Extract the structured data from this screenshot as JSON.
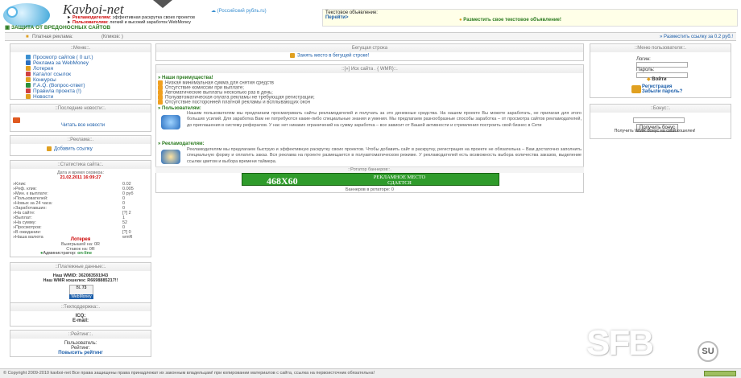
{
  "header": {
    "logo_text": "Kavboi-net",
    "slogan_1_bold": "Рекламодателям:",
    "slogan_1": "эффективная раскрутка своих проектов",
    "slogan_2_bold": "Пользователям:",
    "slogan_2": "легкий и высокий заработок WebMoney",
    "shield": "ЗАЩИТА ОТ ВРЕДОНОСНЫХ САЙТОВ",
    "yandex_link": "(Российский рубль.ru)",
    "ad_title": "Текстовое объявление:",
    "ad_go": "Перейти>",
    "ad_place": "Разместить свое текстовое объявление!"
  },
  "topbar": {
    "paid": "Платная реклама:",
    "click": "(Кликов: )",
    "place_link": "» Разместить ссылку за 0.2 руб.!"
  },
  "left": {
    "menu_title": "::Меню::.",
    "menu": [
      {
        "label": "Просмотр сайтов ( 0 шт.)",
        "icon": "magnifier-icon",
        "color": "#3a8fd0"
      },
      {
        "label": "Реклама за WebMoney",
        "icon": "webmoney-icon",
        "color": "#2a6fc0"
      },
      {
        "label": "Лотерея",
        "icon": "lottery-icon",
        "color": "#e0a020"
      },
      {
        "label": "Каталог ссылок",
        "icon": "catalog-icon",
        "color": "#d04040"
      },
      {
        "label": "Конкурсы",
        "icon": "contest-icon",
        "color": "#e0a020"
      },
      {
        "label": "F.A.Q. (Вопрос-ответ)",
        "icon": "faq-icon",
        "color": "#2a8f3a"
      },
      {
        "label": "Правила проекта (!)",
        "icon": "rules-icon",
        "color": "#d04040"
      },
      {
        "label": "Новости",
        "icon": "news-icon",
        "color": "#e0a020"
      }
    ],
    "news_title": "::Последние новости::.",
    "news_link": "Читать все новости",
    "ads_title": "::Реклама::.",
    "ads_link": "Добавить ссылку",
    "stats_title": "::Статистика сайта::.",
    "stats_date_label": "Дата и время сервера:",
    "stats_date": "21.02.2011 16:09:27",
    "stats": [
      {
        "k": "»Клик:",
        "v": "0.02"
      },
      {
        "k": "»Реф. клик:",
        "v": "0.005"
      },
      {
        "k": "»Мин. к выплате:",
        "v": "0 руб"
      },
      {
        "k": "»Пользователей:",
        "v": "0"
      },
      {
        "k": "»Новых за 24 часа:",
        "v": "0"
      },
      {
        "k": "»Заработавших:",
        "v": "0"
      },
      {
        "k": "»На сайте:",
        "v": "[?] 2"
      },
      {
        "k": "»Выплат:",
        "v": "1"
      },
      {
        "k": "»На сумму:",
        "v": "52"
      },
      {
        "k": "»Просмотров:",
        "v": "0"
      },
      {
        "k": "»В ожидании:",
        "v": "[?] 0"
      },
      {
        "k": "»Наша валюта",
        "v": "wmR"
      }
    ],
    "lottery_title": "Лотерея",
    "lottery_win": "Выигрышей на: 0R",
    "lottery_bets": "Ставок на: 0R",
    "admin": "Администратор:",
    "admin_status": "on-line",
    "pay_title": "::Платежные данные::.",
    "wmid": "Наш WMID: 362083591943",
    "wmr": "Наш WMR кошелек: R6698885217!!",
    "bl_label": "BL",
    "bl_value": "73",
    "wm_badge": "WebMoney",
    "support_title": "::Техподдержка::.",
    "icq": "ICQ:",
    "email": "E-mail:",
    "rating_title": "::Рейтинг::.",
    "rating_users": "Пользователь:",
    "rating_label": "Рейтинг:",
    "rating_link": "Повысить рейтинг"
  },
  "center": {
    "ticker_title": "Бегущая строка",
    "ticker_link": "Занять место в бегущей строке!",
    "income_title": "::[»] Иск сайта . { WMR}::.",
    "adv_title": "» Наши преимущества!",
    "adv": [
      "Низкая минимальная сумма для снятия средств",
      "Отсутствие комиссии при выплате;",
      "Автоматические выплаты несколько раз в день;",
      "Полуавтоматическая оплата рекламы не требующая регистрации;",
      "Отсутствие посторонней платной рекламы и всплывающих окон"
    ],
    "users_title": "» Пользователям:",
    "users_text": "Нашим пользователям мы предлагаем просматривать сайты рекламодателей и получать за это денежные средства. На нашем проекте Вы можете заработать, не прилагая для этого больших усилий. Для заработка Вам не потребуются какие-либо специальные знания и умения. Мы предлагаем разнообразные способы заработка – от просмотра сайтов рекламодателей, до приглашения в систему рефералов. У нас нет никаких ограничений на сумму заработка – все зависит от Вашей активности и стремления построить свой бизнес в Сети",
    "advertisers_title": "» Рекламодателям:",
    "advertisers_text": "Рекламодателям мы предлагаем быструю и эффективную раскрутку своих проектов. Чтобы добавить сайт в раскрутку, регистрация на проекте не обязательна – Вам достаточно заполнить специальную форму и оплатить заказ. Вся реклама на проекте размещается в полуавтоматическом режиме. У рекламодателей есть возможность выбора количества заказов, выделение ссылки цветом и выбора времени таймера.",
    "rotator_title": "::Ротатор баннеров::.",
    "banner_size": "468X60",
    "banner_text": "РЕКЛАМНОЕ МЕСТО СДАЕТСЯ",
    "rotator_count": "Баннеров в ротаторе: 0"
  },
  "right": {
    "user_menu_title": "::Меню пользователя::.",
    "login_label": "Логин:",
    "password_label": "Пароль:",
    "login_btn": "Войти",
    "register": "Регистрация",
    "forgot": "Забыли пароль?",
    "bonus_title": "::Бонус::.",
    "bonus_btn": "Получить бонус",
    "bonus_text": "Получить WMR бонус на свой кошелек!"
  },
  "footer": {
    "copyright": "© Copyright 2009-2010 kavboi-net Все права защищены права принадлежат их законным владельцам! при копировании материалов с сайта, ссылка на первоисточник обязательна!"
  },
  "watermark": {
    "brand": "SFB",
    "suffix": "SU"
  }
}
